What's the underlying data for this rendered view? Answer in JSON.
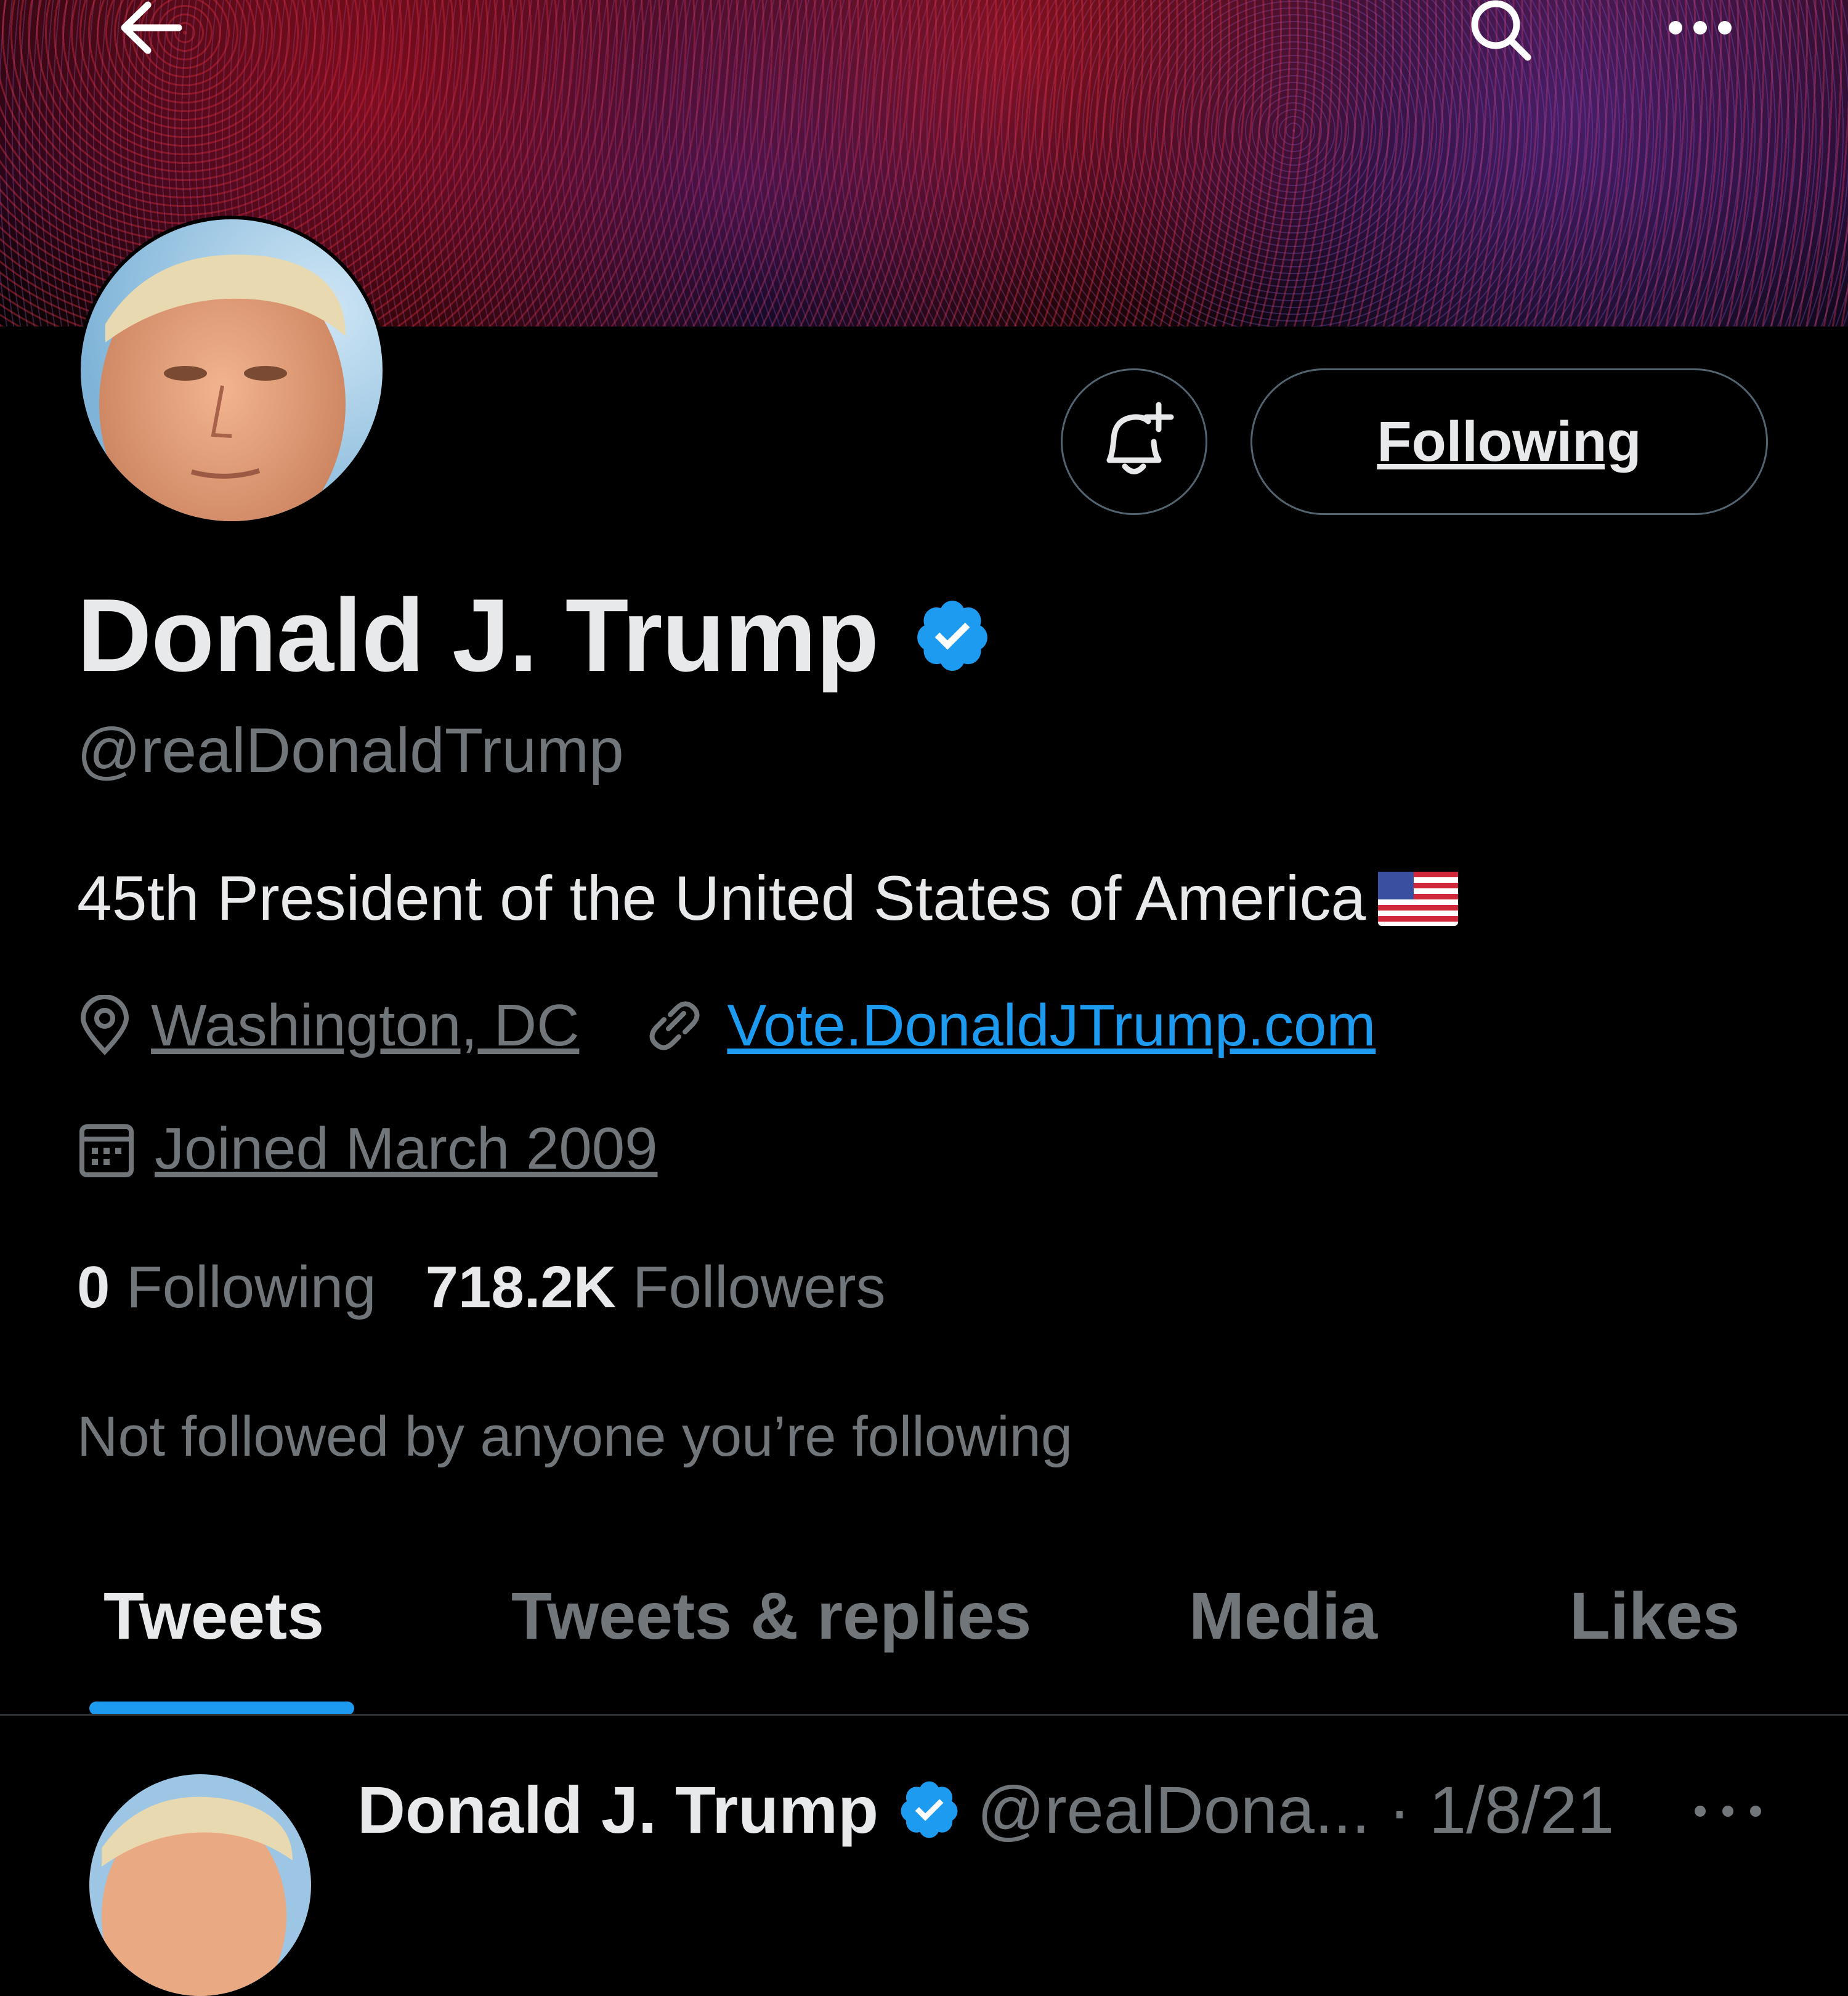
{
  "profile": {
    "name": "Donald J. Trump",
    "handle": "@realDonaldTrump",
    "bio": "45th President of the United States of America",
    "location": "Washington, DC",
    "website": "Vote.DonaldJTrump.com",
    "joined": "Joined March 2009",
    "following_count": "0",
    "following_label": "Following",
    "followers_count": "718.2K",
    "followers_label": "Followers",
    "mutuals_note": "Not followed by anyone you’re following"
  },
  "actions": {
    "following_button": "Following"
  },
  "tabs": [
    {
      "label": "Tweets",
      "active": true
    },
    {
      "label": "Tweets & replies",
      "active": false
    },
    {
      "label": "Media",
      "active": false
    },
    {
      "label": "Likes",
      "active": false
    }
  ],
  "tweet": {
    "author_name": "Donald J. Trump",
    "author_handle_date": "@realDona... · 1/8/21"
  },
  "icons": {
    "back": "arrow-left-icon",
    "search": "search-icon",
    "more": "more-icon",
    "notify": "bell-plus-icon",
    "verified": "verified-badge-icon",
    "location": "location-pin-icon",
    "link": "link-icon",
    "calendar": "calendar-icon",
    "flag": "us-flag-emoji"
  },
  "colors": {
    "background": "#000000",
    "accent": "#1d9bf0",
    "text_primary": "#e7e9ea",
    "text_secondary": "#71767b"
  }
}
